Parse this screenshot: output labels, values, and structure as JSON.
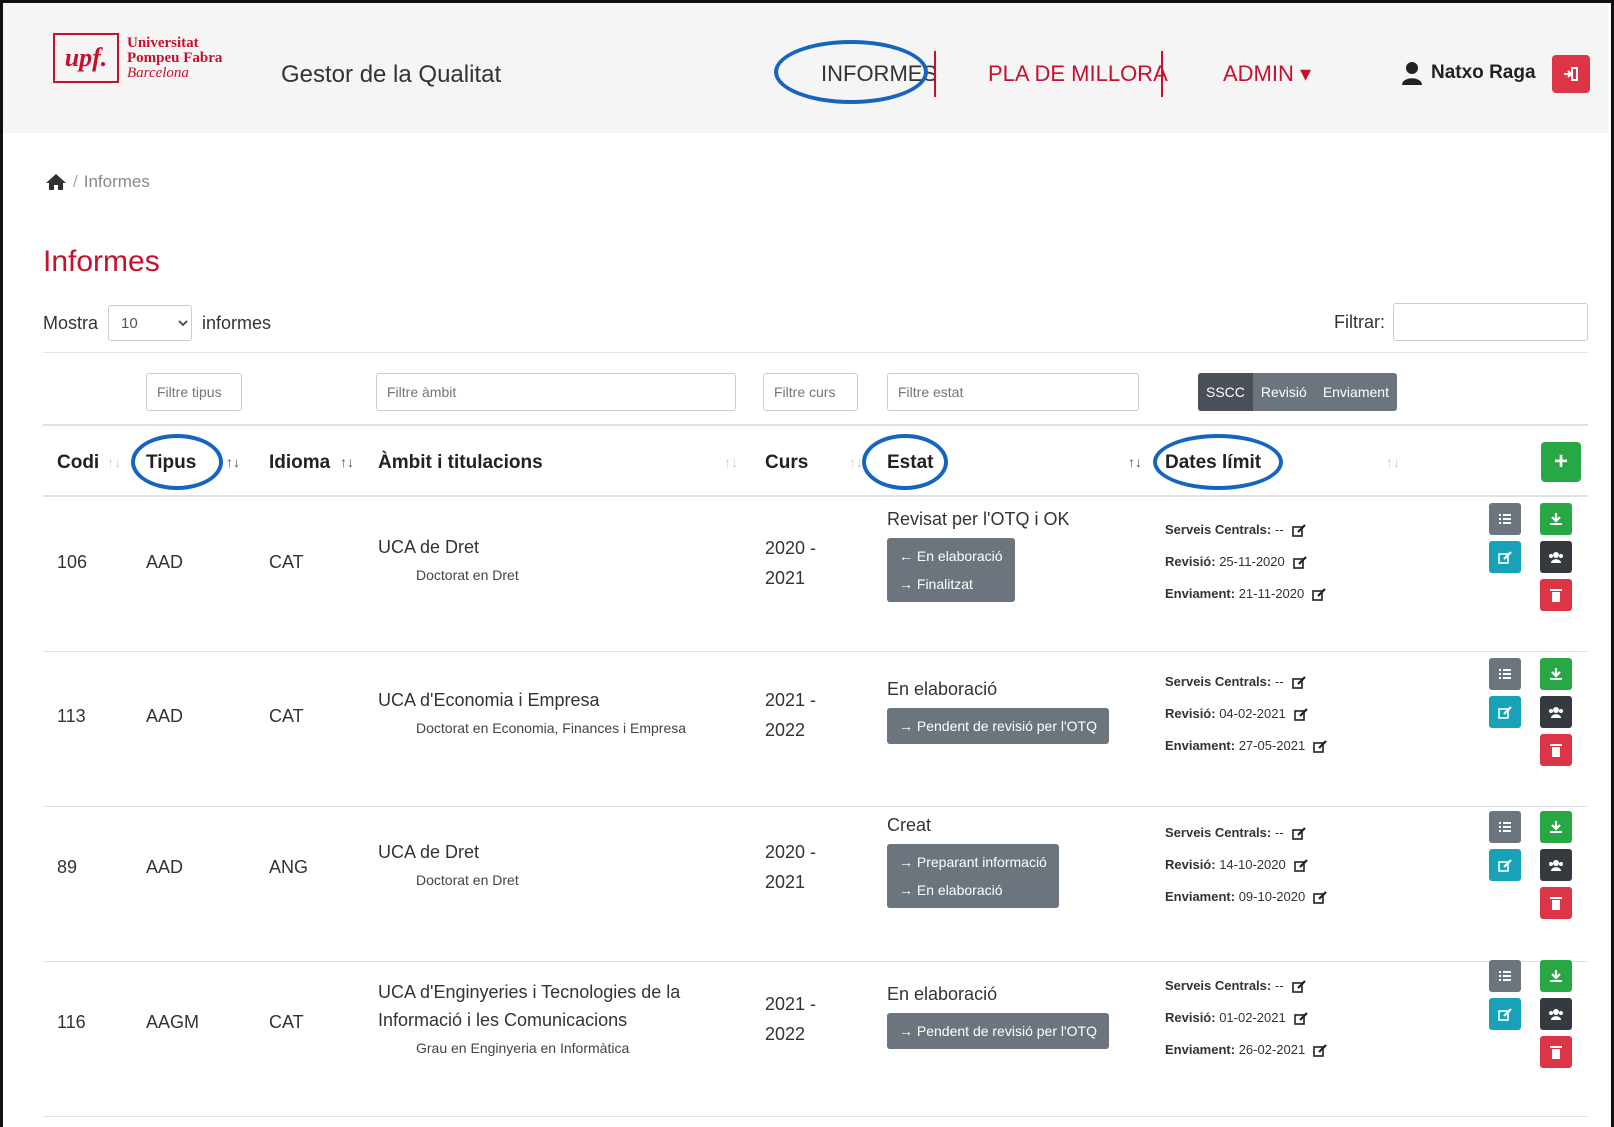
{
  "brand": {
    "logo_mark": "upf.",
    "logo_line1": "Universitat",
    "logo_line2": "Pompeu Fabra",
    "logo_line3": "Barcelona",
    "app_title": "Gestor de la Qualitat"
  },
  "nav": {
    "informes": "INFORMES",
    "pla_millora": "PLA DE MILLORA",
    "admin": "ADMIN ▾",
    "user_name": "Natxo Raga"
  },
  "breadcrumb": {
    "current": "Informes"
  },
  "page": {
    "title": "Informes",
    "show_prefix": "Mostra",
    "show_value": "10",
    "show_suffix": "informes",
    "filter_label": "Filtrar:"
  },
  "filters": {
    "tipus_placeholder": "Filtre tipus",
    "ambit_placeholder": "Filtre àmbit",
    "curs_placeholder": "Filtre curs",
    "estat_placeholder": "Filtre estat",
    "seg_sscc": "SSCC",
    "seg_revisio": "Revisió",
    "seg_enviament": "Enviament"
  },
  "columns": {
    "codi": "Codi",
    "tipus": "Tipus",
    "idioma": "Idioma",
    "ambit": "Àmbit i titulacions",
    "curs": "Curs",
    "estat": "Estat",
    "dates": "Dates límit",
    "add": "+"
  },
  "labels": {
    "serveis": "Serveis Centrals:",
    "revisio": "Revisió:",
    "enviament": "Enviament:"
  },
  "rows": [
    {
      "codi": "106",
      "tipus": "AAD",
      "idioma": "CAT",
      "ambit": "UCA de Dret",
      "titulacio": "Doctorat en Dret",
      "curs1": "2020 -",
      "curs2": "2021",
      "estat": "Revisat per l'OTQ i OK",
      "action1": "← En elaboració",
      "action2": "→ Finalitzat",
      "serveis": "--",
      "revisio": "25-11-2020",
      "enviament": "21-11-2020"
    },
    {
      "codi": "113",
      "tipus": "AAD",
      "idioma": "CAT",
      "ambit": "UCA d'Economia i Empresa",
      "titulacio": "Doctorat en Economia, Finances i Empresa",
      "curs1": "2021 -",
      "curs2": "2022",
      "estat": "En elaboració",
      "action1": "→ Pendent de revisió per l'OTQ",
      "serveis": "--",
      "revisio": "04-02-2021",
      "enviament": "27-05-2021"
    },
    {
      "codi": "89",
      "tipus": "AAD",
      "idioma": "ANG",
      "ambit": "UCA de Dret",
      "titulacio": "Doctorat en Dret",
      "curs1": "2020 -",
      "curs2": "2021",
      "estat": "Creat",
      "action1": "→ Preparant informació",
      "action2": "→ En elaboració",
      "serveis": "--",
      "revisio": "14-10-2020",
      "enviament": "09-10-2020"
    },
    {
      "codi": "116",
      "tipus": "AAGM",
      "idioma": "CAT",
      "ambit": "UCA d'Enginyeries i Tecnologies de la",
      "ambit2": "Informació i les Comunicacions",
      "titulacio": "Grau en Enginyeria en Informàtica",
      "curs1": "2021 -",
      "curs2": "2022",
      "estat": "En elaboració",
      "action1": "→ Pendent de revisió per l'OTQ",
      "serveis": "--",
      "revisio": "01-02-2021",
      "enviament": "26-02-2021"
    }
  ],
  "colors": {
    "brand_red": "#c8102e",
    "annotation_blue": "#1565c0",
    "success": "#28a745",
    "info": "#17a2b8",
    "danger": "#dc3545",
    "secondary": "#6c757d",
    "dark": "#343a40"
  },
  "icons": [
    "home-icon",
    "user-icon",
    "logout-icon",
    "plus-icon",
    "list-icon",
    "download-icon",
    "edit-icon",
    "users-icon",
    "trash-icon",
    "sort-icon"
  ]
}
